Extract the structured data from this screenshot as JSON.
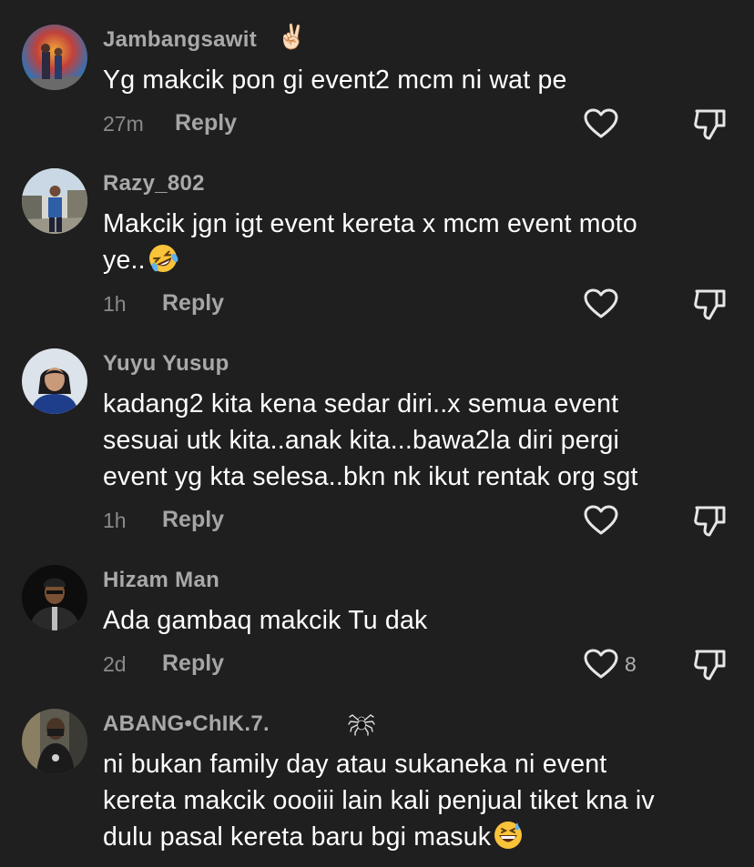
{
  "reply_label": "Reply",
  "comments": [
    {
      "username": "Jambangsawit",
      "username_emoji": "✌🏻",
      "lines": [
        "Yg makcik pon gi event2 mcm ni wat pe"
      ],
      "time": "27m",
      "likes": "",
      "avatar": "avatar-colorful-background"
    },
    {
      "username": "Razy_802",
      "lines": [
        "Makcik jgn igt event kereta x mcm event moto",
        "ye.."
      ],
      "text_emoji": "rolling-on-floor-laughing",
      "time": "1h",
      "likes": "",
      "avatar": "avatar-man-outdoors"
    },
    {
      "username": "Yuyu Yusup",
      "lines": [
        "kadang2 kita kena sedar diri..x semua event",
        "sesuai utk kita..anak kita...bawa2la diri pergi",
        "event yg kta selesa..bkn nk ikut rentak org sgt"
      ],
      "time": "1h",
      "likes": "",
      "avatar": "avatar-woman-portrait"
    },
    {
      "username": "Hizam Man",
      "lines": [
        "Ada gambaq makcik Tu dak"
      ],
      "time": "2d",
      "likes": "8",
      "avatar": "avatar-man-dark"
    },
    {
      "username": "ABANG•ChIK.7.",
      "username_emoji": "🕷️",
      "lines": [
        "ni bukan family day atau sukaneka ni event",
        "kereta makcik oooiii lain kali penjual tiket kna iv",
        "dulu pasal kereta baru bgi masuk"
      ],
      "text_emoji": "grinning-sweat",
      "time": "",
      "likes": "",
      "avatar": "avatar-man-mask"
    }
  ],
  "colors": {
    "background": "#1f1f1f",
    "username": "#a9a9a9",
    "text": "#ffffff",
    "meta": "#8a8a8a",
    "icon": "#e6e6e6"
  }
}
